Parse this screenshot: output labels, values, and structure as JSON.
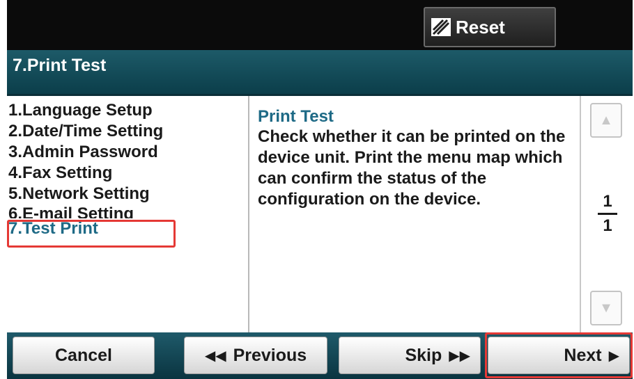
{
  "header": {
    "reset_label": "Reset",
    "reset_icon": "reset-icon"
  },
  "title": "7.Print Test",
  "menu": {
    "items": [
      {
        "label": "1.Language Setup"
      },
      {
        "label": "2.Date/Time Setting"
      },
      {
        "label": "3.Admin Password"
      },
      {
        "label": "4.Fax Setting"
      },
      {
        "label": "5.Network Setting"
      },
      {
        "label": "6.E-mail Setting"
      },
      {
        "label": "7.Test Print"
      }
    ],
    "selected_index": 6
  },
  "description": {
    "title": "Print Test",
    "body": "Check whether it can be printed on the device unit. Print the menu map which can confirm the status of the configuration on the device."
  },
  "pager": {
    "current": "1",
    "total": "1",
    "up_icon": "up-arrow-icon",
    "down_icon": "down-arrow-icon"
  },
  "footer": {
    "cancel_label": "Cancel",
    "previous_label": "Previous",
    "skip_label": "Skip",
    "next_label": "Next"
  },
  "colors": {
    "highlight": "#e53935",
    "accent": "#1e6a86"
  }
}
